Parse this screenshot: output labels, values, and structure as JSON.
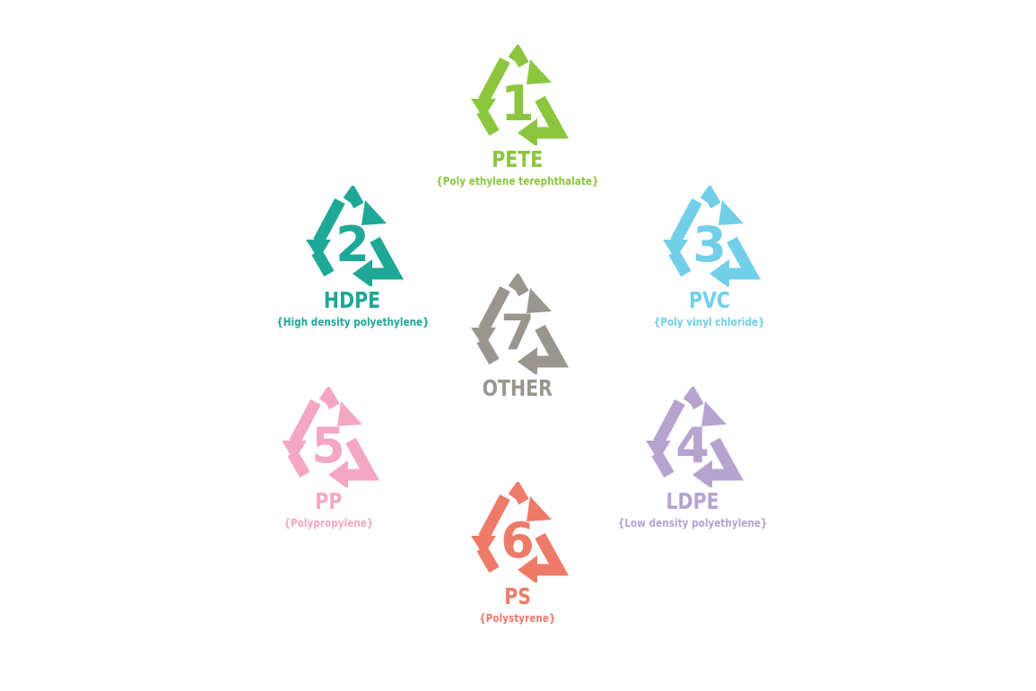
{
  "codes": [
    {
      "number": "1",
      "abbr": "PETE",
      "full": "{Poly ethylene terephthalate}",
      "color": "#8cc63f"
    },
    {
      "number": "2",
      "abbr": "HDPE",
      "full": "{High density polyethylene}",
      "color": "#1fa898"
    },
    {
      "number": "3",
      "abbr": "PVC",
      "full": "{Poly vinyl chloride}",
      "color": "#72cfe8"
    },
    {
      "number": "7",
      "abbr": "OTHER",
      "full": "",
      "color": "#9a958d"
    },
    {
      "number": "5",
      "abbr": "PP",
      "full": "{Polypropylene}",
      "color": "#f4a7c5"
    },
    {
      "number": "4",
      "abbr": "LDPE",
      "full": "{Low density polyethylene}",
      "color": "#b6a3d0"
    },
    {
      "number": "6",
      "abbr": "PS",
      "full": "{Polystyrene}",
      "color": "#ee7b68"
    }
  ]
}
